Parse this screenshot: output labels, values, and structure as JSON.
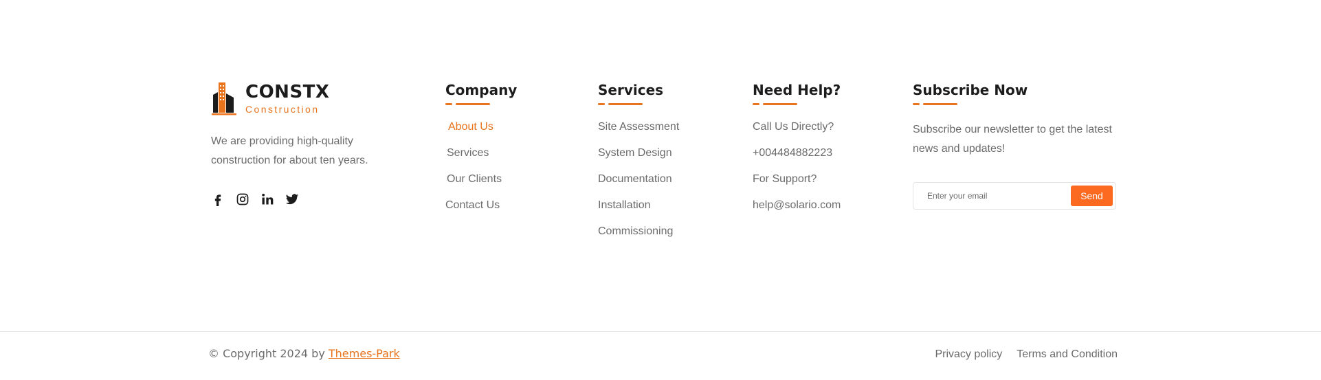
{
  "brand": {
    "name": "CONSTX",
    "tagline": "Construction",
    "description": "We are providing high-quality construction for about ten years.",
    "accent_color": "#e8741e",
    "social": [
      "facebook-icon",
      "instagram-icon",
      "linkedin-icon",
      "twitter-icon"
    ]
  },
  "company": {
    "title": "Company",
    "links": [
      "About Us",
      "Services",
      "Our Clients",
      "Contact Us"
    ]
  },
  "services": {
    "title": "Services",
    "links": [
      "Site Assessment",
      "System Design",
      "Documentation",
      "Installation",
      "Commissioning"
    ]
  },
  "help": {
    "title": "Need Help?",
    "items": [
      "Call Us Directly?",
      "+004484882223",
      "For Support?",
      "help@solario.com"
    ]
  },
  "subscribe": {
    "title": "Subscribe Now",
    "description": "Subscribe our newsletter to get the latest news and updates!",
    "placeholder": "Enter your email",
    "button_label": "Send",
    "button_color": "#fb6a20"
  },
  "bottom": {
    "copyright_prefix": "© Copyright 2024 by ",
    "copyright_link": "Themes-Park",
    "links": [
      "Privacy policy",
      "Terms and Condition"
    ]
  }
}
